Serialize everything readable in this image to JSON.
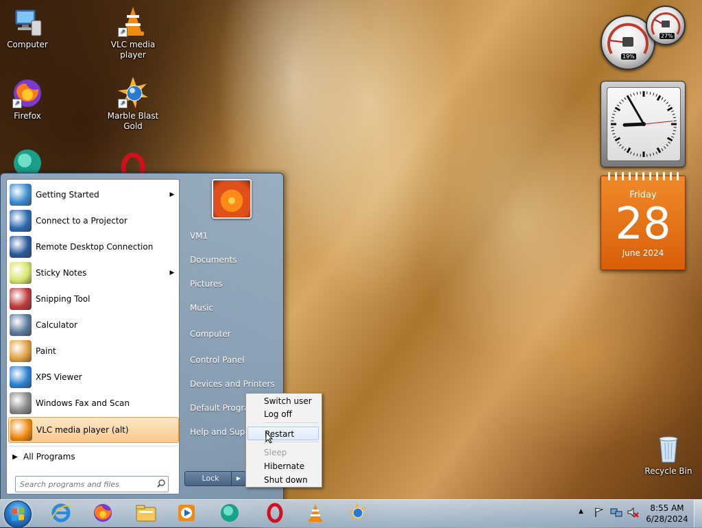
{
  "desktop": {
    "icons": [
      {
        "label": "Computer"
      },
      {
        "label": "VLC media player"
      },
      {
        "label": "Firefox"
      },
      {
        "label": "Marble Blast Gold"
      },
      {
        "label": "Recycle Bin"
      }
    ]
  },
  "gadgets": {
    "cpu_meter": {
      "cpu_percent": "19%",
      "memory_percent": "27%",
      "cpu_value": 19,
      "memory_value": 27
    },
    "clock": {
      "hour": 8,
      "minute": 55,
      "second": 14
    },
    "calendar": {
      "weekday": "Friday",
      "day": "28",
      "month_year": "June 2024"
    }
  },
  "start_menu": {
    "programs": [
      {
        "label": "Getting Started",
        "has_submenu": true,
        "icon": "getting-started-icon",
        "color": "#3a8ad0"
      },
      {
        "label": "Connect to a Projector",
        "has_submenu": false,
        "icon": "projector-icon",
        "color": "#2a6ab0"
      },
      {
        "label": "Remote Desktop Connection",
        "has_submenu": false,
        "icon": "remote-desktop-icon",
        "color": "#2a5a9a"
      },
      {
        "label": "Sticky Notes",
        "has_submenu": true,
        "icon": "sticky-notes-icon",
        "color": "#d8e46a"
      },
      {
        "label": "Snipping Tool",
        "has_submenu": false,
        "icon": "scissors-icon",
        "color": "#c03a3a"
      },
      {
        "label": "Calculator",
        "has_submenu": false,
        "icon": "calculator-icon",
        "color": "#5a7a9a"
      },
      {
        "label": "Paint",
        "has_submenu": false,
        "icon": "paint-icon",
        "color": "#e0a040"
      },
      {
        "label": "XPS Viewer",
        "has_submenu": false,
        "icon": "xps-viewer-icon",
        "color": "#2a80d0"
      },
      {
        "label": "Windows Fax and Scan",
        "has_submenu": false,
        "icon": "fax-icon",
        "color": "#8a8a8a"
      },
      {
        "label": "VLC media player (alt)",
        "has_submenu": false,
        "icon": "vlc-icon",
        "color": "#f08a10"
      }
    ],
    "all_programs": "All Programs",
    "search_placeholder": "Search programs and files",
    "right_items": [
      {
        "label": "VM1"
      },
      {
        "label": "Documents"
      },
      {
        "label": "Pictures"
      },
      {
        "label": "Music"
      },
      {
        "label": "Computer"
      },
      {
        "label": "Control Panel"
      },
      {
        "label": "Devices and Printers"
      },
      {
        "label": "Default Programs"
      },
      {
        "label": "Help and Support"
      }
    ],
    "lock_label": "Lock"
  },
  "power_menu": {
    "items": [
      {
        "label": "Switch user",
        "enabled": true
      },
      {
        "label": "Log off",
        "enabled": true
      },
      {
        "label": "Restart",
        "enabled": true,
        "highlighted": true
      },
      {
        "label": "Sleep",
        "enabled": false
      },
      {
        "label": "Hibernate",
        "enabled": true
      },
      {
        "label": "Shut down",
        "enabled": true
      }
    ]
  },
  "taskbar": {
    "pinned": [
      {
        "name": "internet-explorer-icon"
      },
      {
        "name": "firefox-icon"
      },
      {
        "name": "windows-explorer-icon"
      },
      {
        "name": "media-player-icon"
      },
      {
        "name": "app-icon"
      },
      {
        "name": "opera-icon"
      },
      {
        "name": "vlc-icon"
      },
      {
        "name": "marble-blast-icon"
      }
    ],
    "time": "8:55 AM",
    "date": "6/28/2024"
  }
}
